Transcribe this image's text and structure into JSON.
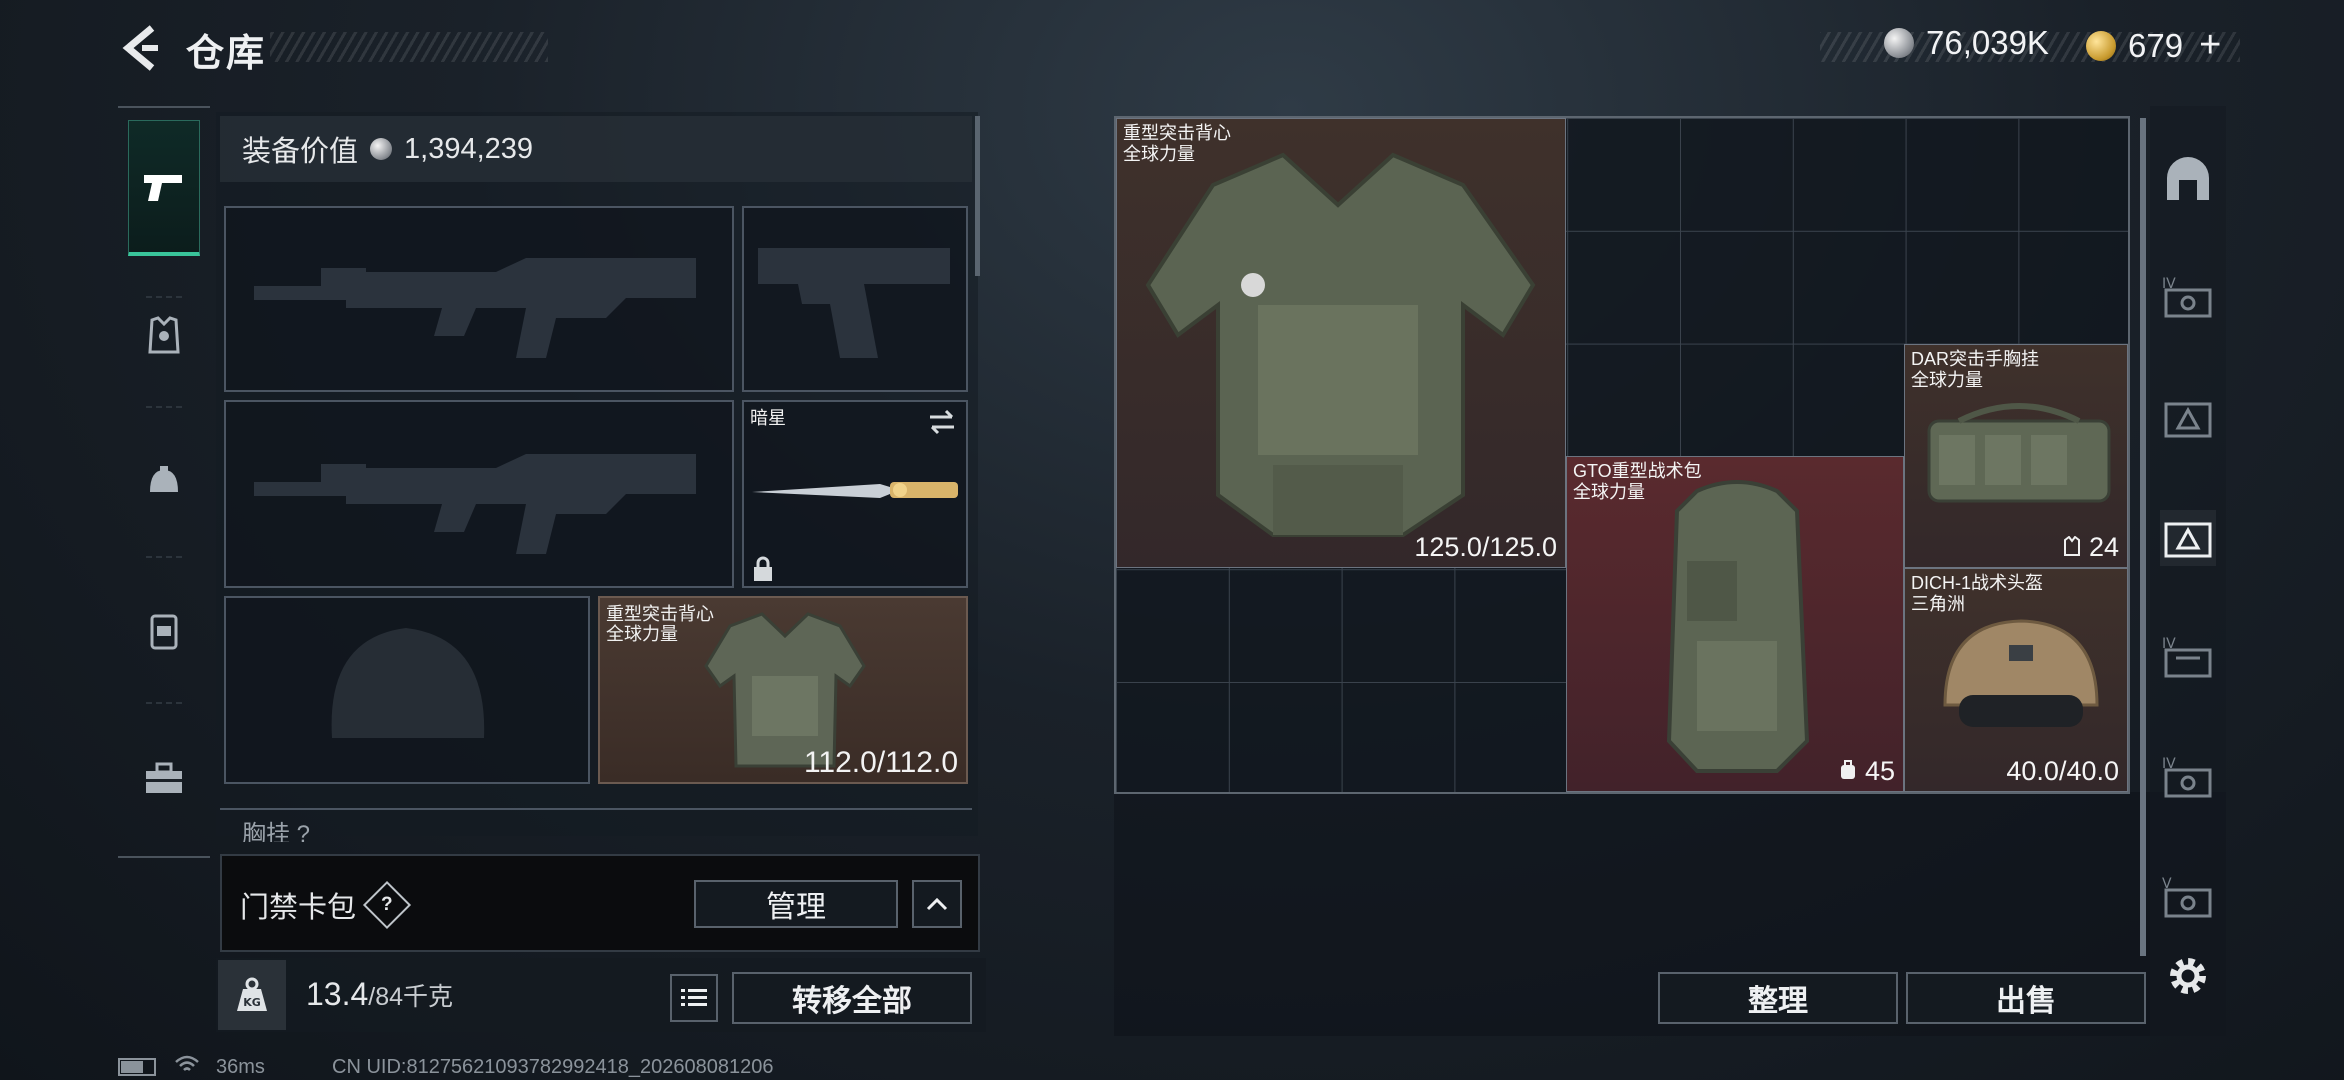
{
  "header": {
    "title": "仓库"
  },
  "currency": {
    "silver_amount": "76,039K",
    "gold_amount": "679",
    "plus": "+"
  },
  "equipment": {
    "value_label": "装备价值",
    "value_amount": "1,394,239",
    "melee": {
      "label": "暗星"
    },
    "vest": {
      "name_line1": "重型突击背心",
      "name_line2": "全球力量",
      "durability": "112.0/112.0"
    },
    "section_cut_label": "胸挂 ?"
  },
  "keycard": {
    "label": "门禁卡包",
    "help": "?",
    "manage_label": "管理"
  },
  "weight": {
    "current": "13.4",
    "max": "/84千克"
  },
  "buttons": {
    "transfer_all": "转移全部",
    "sort": "整理",
    "sell": "出售"
  },
  "container_items": [
    {
      "name_line1": "重型突击背心",
      "name_line2": "全球力量",
      "value": "125.0/125.0"
    },
    {
      "name_line1": "GTO重型战术包",
      "name_line2": "全球力量",
      "value": "45"
    },
    {
      "name_line1": "DAR突击手胸挂",
      "name_line2": "全球力量",
      "value": "24"
    },
    {
      "name_line1": "DICH-1战术头盔",
      "name_line2": "三角洲",
      "value": "40.0/40.0"
    }
  ],
  "status": {
    "ping": "36ms",
    "uid": "CN UID:81275621093782992418_202608081206"
  },
  "colors": {
    "accent": "#39c49a",
    "vest_bg": "#3f312b",
    "backpack_bg": "#5a2a2e"
  },
  "icons": [
    "back-arrow-icon",
    "pistol-icon",
    "armor-icon",
    "helmet-icon",
    "backpack-icon",
    "toolbox-icon",
    "lock-icon",
    "swap-icon",
    "list-icon",
    "kg-weight-icon",
    "gear-icon",
    "safe-icon"
  ]
}
